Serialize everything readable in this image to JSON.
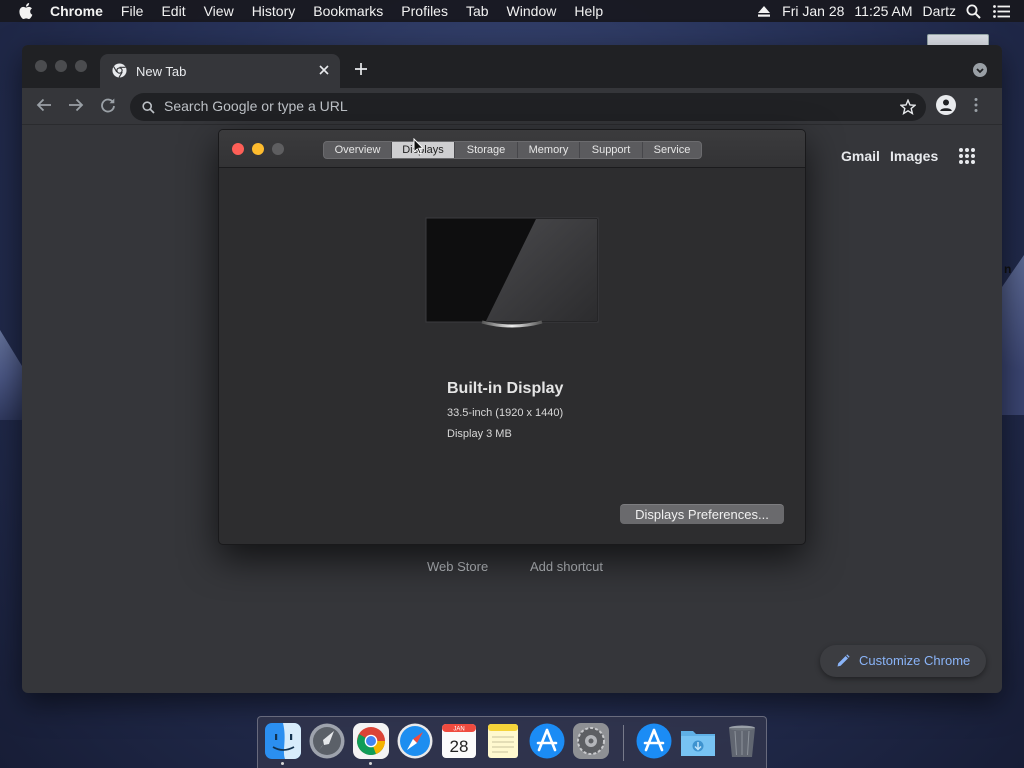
{
  "menubar": {
    "app_name": "Chrome",
    "items": [
      "File",
      "Edit",
      "View",
      "History",
      "Bookmarks",
      "Profiles",
      "Tab",
      "Window",
      "Help"
    ],
    "date": "Fri Jan 28",
    "time": "11:25 AM",
    "user": "Dartz",
    "icons": [
      "apple-icon",
      "eject-icon",
      "spotlight-search-icon",
      "notification-center-icon"
    ]
  },
  "chrome": {
    "tab_title": "New Tab",
    "omnibox_placeholder": "Search Google or type a URL",
    "ntp": {
      "gmail": "Gmail",
      "images": "Images",
      "web_store": "Web Store",
      "add_shortcut": "Add shortcut",
      "customize": "Customize Chrome"
    }
  },
  "about_mac": {
    "tabs": [
      "Overview",
      "Displays",
      "Storage",
      "Memory",
      "Support",
      "Service"
    ],
    "selected_tab": "Displays",
    "display_name": "Built-in Display",
    "display_size": "33.5-inch (1920 x 1440)",
    "display_memory": "Display 3 MB",
    "prefs_button": "Displays Preferences..."
  },
  "desktop": {
    "partial_text": "n"
  },
  "dock": {
    "items": [
      "finder",
      "launchpad",
      "chrome",
      "safari",
      "calendar",
      "notes",
      "app-store",
      "system-preferences",
      "app-store-2",
      "downloads",
      "trash"
    ],
    "calendar_month": "JAN",
    "calendar_day": "28",
    "running": [
      "finder",
      "chrome"
    ]
  },
  "colors": {
    "close": "#fe5f57",
    "minimize": "#febc2e",
    "inactive": "#5e5e60",
    "link_blue": "#8ab4f8"
  }
}
